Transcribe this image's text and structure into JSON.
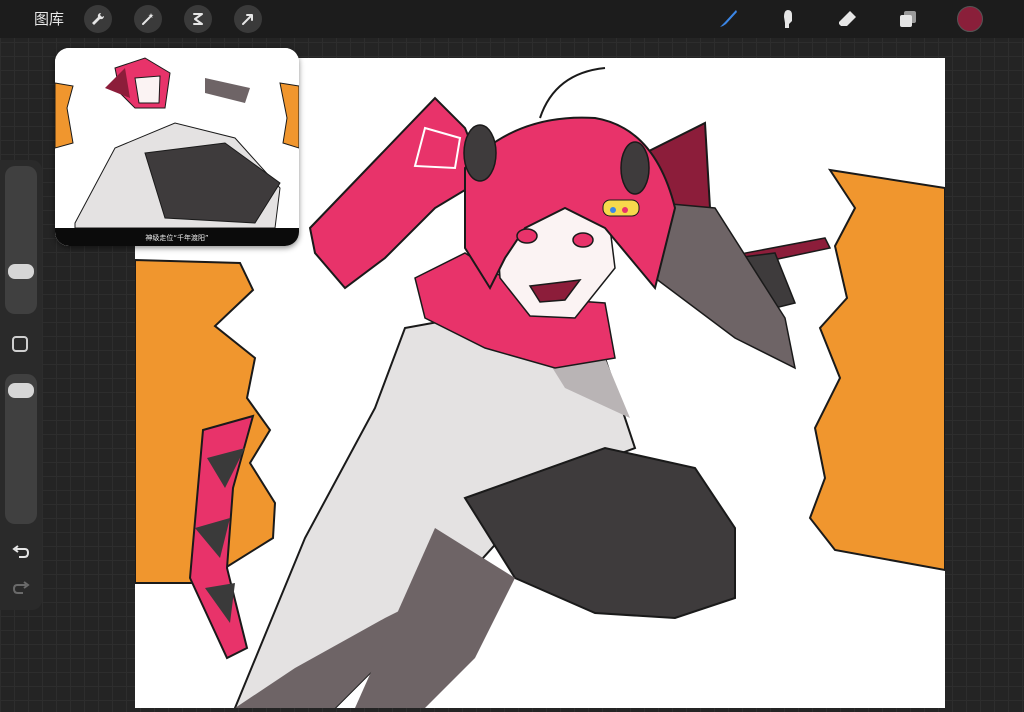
{
  "app": {
    "gallery_label": "图库"
  },
  "toolbar": {
    "left_tools": [
      "wrench-icon",
      "magic-wand-icon",
      "selection-icon",
      "transform-icon"
    ],
    "right_tools": [
      "brush-icon",
      "smudge-icon",
      "eraser-icon",
      "layers-icon"
    ],
    "active_tool": "brush-icon",
    "current_color": "#8a1f3a",
    "active_color": "#3b86e6"
  },
  "sidebar": {
    "brush_size_level": 0.25,
    "opacity_level": 0.95
  },
  "reference": {
    "caption": "神级走位“千年渡阳”"
  },
  "colors": {
    "hair": "#e8336a",
    "hair_dark": "#8c1d3a",
    "orange": "#f0962e",
    "cloak": "#e4e2e2",
    "cloak_shadow": "#6e6466",
    "sleeve": "#3e3b3c"
  }
}
